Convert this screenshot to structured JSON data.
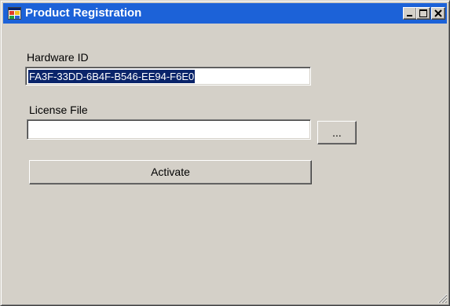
{
  "window": {
    "title": "Product Registration",
    "icon": "application-icon",
    "controls": [
      "minimize-icon",
      "maximize-icon",
      "close-icon"
    ]
  },
  "hardware_id": {
    "label": "Hardware ID",
    "value": "FA3F-33DD-6B4F-B546-EE94-F6E0"
  },
  "license_file": {
    "label": "License File",
    "value": "",
    "placeholder": "",
    "browse_label": "..."
  },
  "actions": {
    "activate_label": "Activate"
  },
  "colors": {
    "titlebar": "#1c62d8",
    "window_bg": "#d4d0c8",
    "selection": "#0a246a"
  }
}
